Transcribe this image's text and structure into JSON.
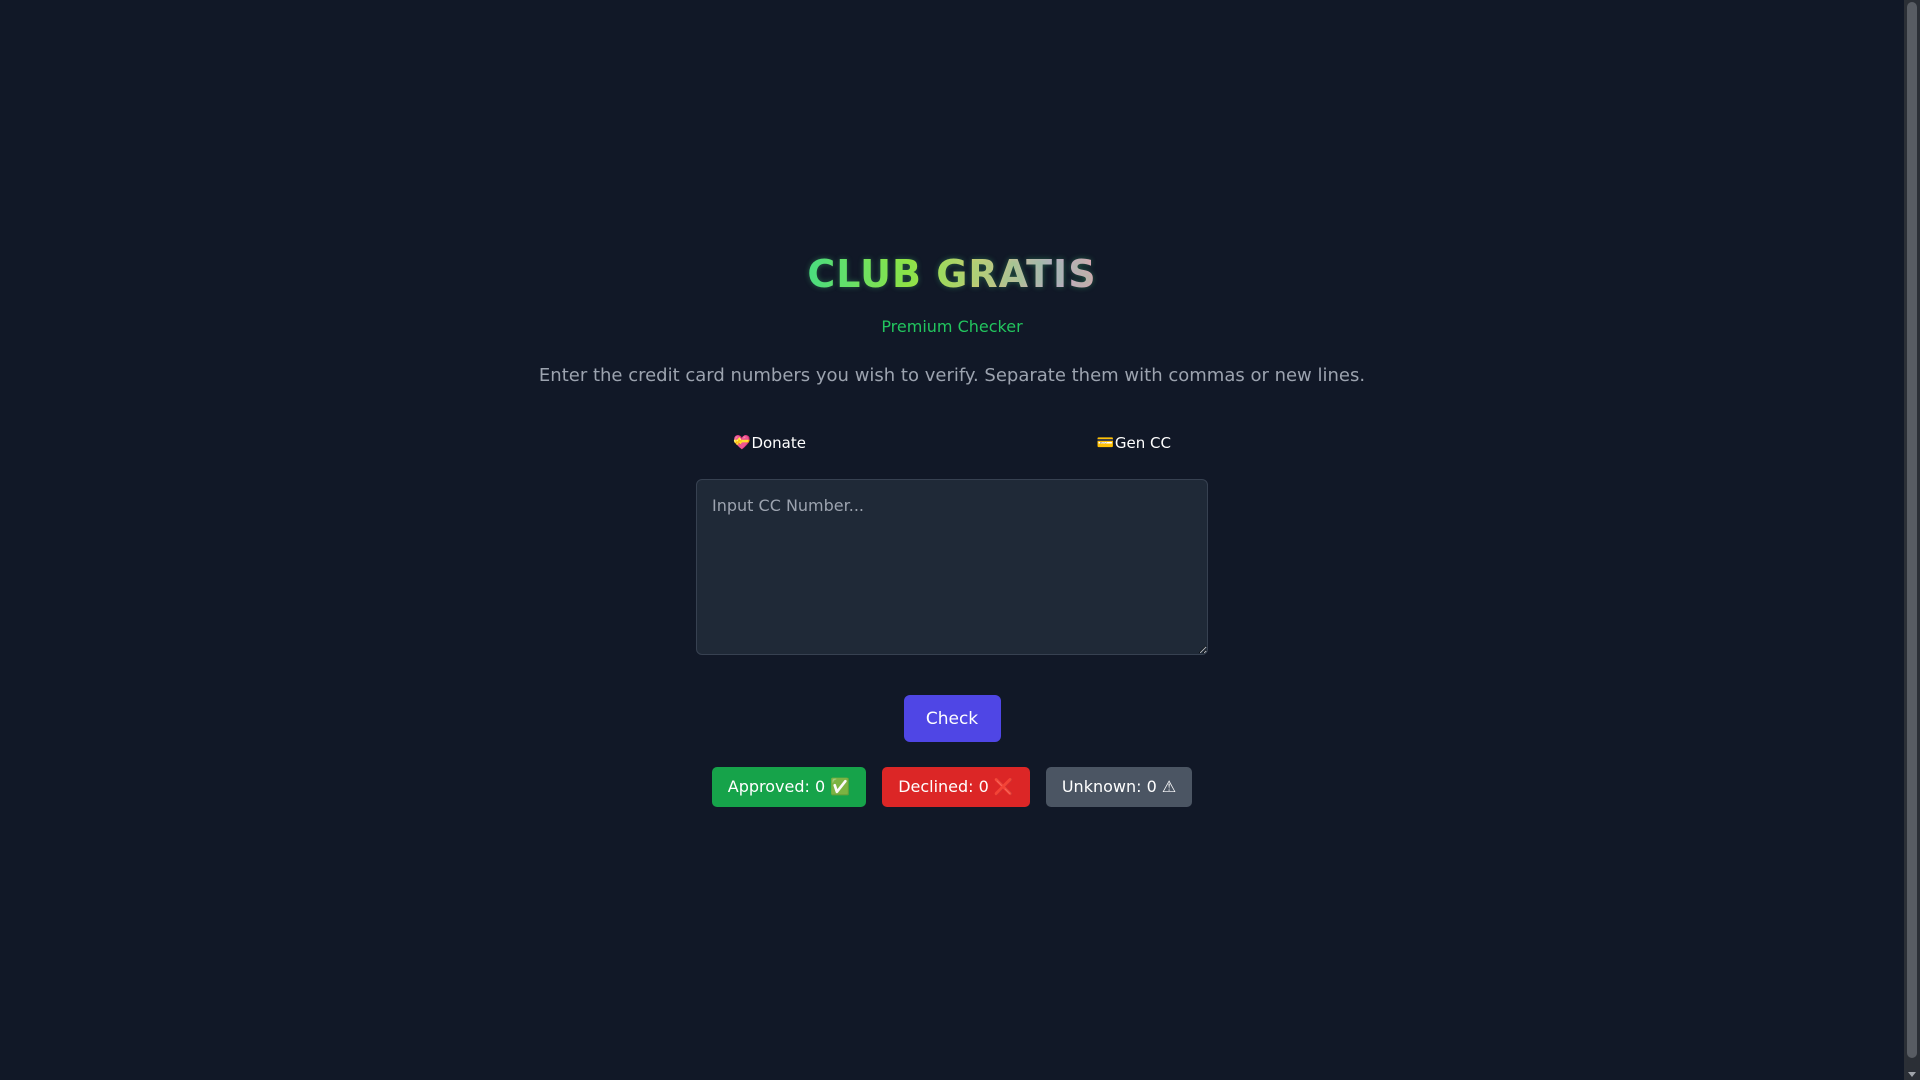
{
  "header": {
    "title": "CLUB GRATIS",
    "subtitle": "Premium Checker",
    "description": "Enter the credit card numbers you wish to verify. Separate them with commas or new lines."
  },
  "links": {
    "donate": {
      "icon": "💝",
      "icon_name": "heart-gift-icon",
      "label": "Donate"
    },
    "gen_cc": {
      "icon": "💳",
      "icon_name": "credit-card-icon",
      "label": "Gen CC"
    }
  },
  "input": {
    "value": "",
    "placeholder": "Input CC Number..."
  },
  "actions": {
    "check_label": "Check"
  },
  "stats": {
    "approved": "Approved: 0 ✅",
    "declined": "Declined: 0 ❌",
    "unknown": "Unknown: 0 ⚠"
  },
  "colors": {
    "background": "#111827",
    "subtitle": "#22c55e",
    "check_button": "#4f46e5",
    "approved": "#16a34a",
    "declined": "#dc2626",
    "unknown": "#4b5563"
  }
}
